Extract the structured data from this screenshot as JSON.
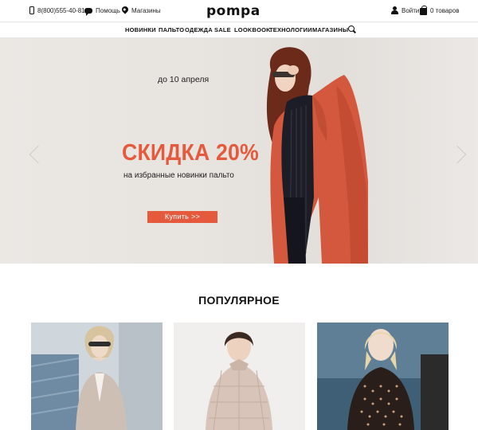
{
  "topbar": {
    "phone": "8(800)555-40-81",
    "help": "Помощь",
    "stores": "Магазины",
    "login": "Войти",
    "cart": "0 товаров"
  },
  "logo": "pompa",
  "nav": {
    "items": [
      "НОВИНКИ",
      "ПАЛЬТО",
      "ОДЕЖДА",
      "SALE",
      "LOOKBOOK",
      "ТЕХНОЛОГИИ",
      "МАГАЗИНЫ"
    ],
    "search_icon": "search-icon"
  },
  "hero": {
    "date": "до 10 апреля",
    "title": "СКИДКА 20%",
    "subtitle": "на избранные новинки пальто",
    "button": "Купить >>",
    "accent_color": "#e55a3d"
  },
  "popular": {
    "title": "ПОПУЛЯРНОЕ",
    "products": [
      "product-1",
      "product-2",
      "product-3"
    ]
  }
}
